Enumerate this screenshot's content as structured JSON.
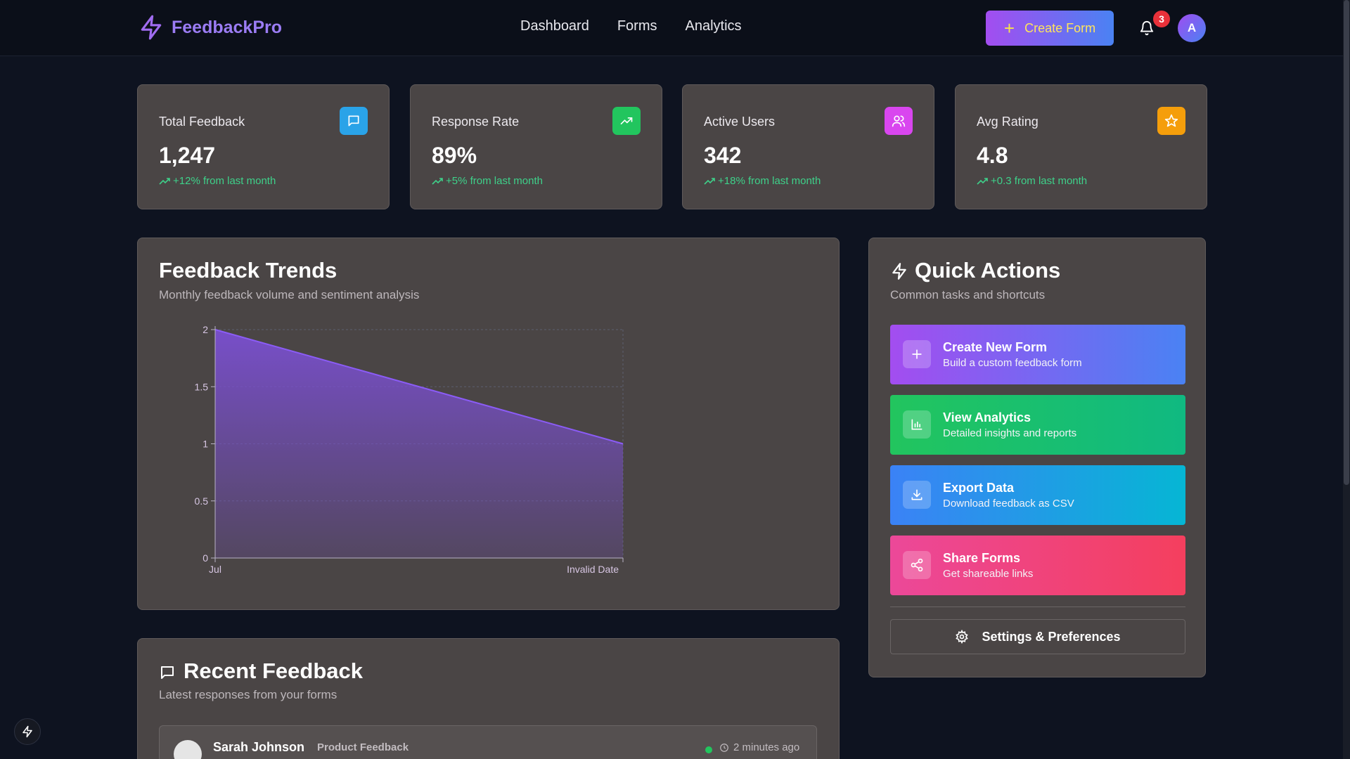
{
  "brand": {
    "name": "FeedbackPro"
  },
  "nav": {
    "items": [
      "Dashboard",
      "Forms",
      "Analytics"
    ]
  },
  "header": {
    "create_label": "Create Form",
    "notification_count": "3",
    "avatar_initial": "A"
  },
  "stats": [
    {
      "label": "Total Feedback",
      "value": "1,247",
      "change": "+12% from last month",
      "icon": "message-icon",
      "color": "#2aa3e8"
    },
    {
      "label": "Response Rate",
      "value": "89%",
      "change": "+5% from last month",
      "icon": "trending-up-icon",
      "color": "#22c55e"
    },
    {
      "label": "Active Users",
      "value": "342",
      "change": "+18% from last month",
      "icon": "users-icon",
      "color": "#d946ef"
    },
    {
      "label": "Avg Rating",
      "value": "4.8",
      "change": "+0.3 from last month",
      "icon": "star-icon",
      "color": "#f59e0b"
    }
  ],
  "trends": {
    "title": "Feedback Trends",
    "subtitle": "Monthly feedback volume and sentiment analysis"
  },
  "chart_data": {
    "type": "area",
    "x": [
      "Jul",
      "Invalid Date"
    ],
    "values": [
      2,
      1
    ],
    "yticks": [
      "0",
      "0.5",
      "1",
      "1.5",
      "2"
    ],
    "ylim": [
      0,
      2
    ],
    "grid": true,
    "fill_color": "#7a4fd0"
  },
  "quick_actions": {
    "title": "Quick Actions",
    "subtitle": "Common tasks and shortcuts",
    "items": [
      {
        "title": "Create New Form",
        "desc": "Build a custom feedback form",
        "icon": "plus-icon"
      },
      {
        "title": "View Analytics",
        "desc": "Detailed insights and reports",
        "icon": "bar-chart-icon"
      },
      {
        "title": "Export Data",
        "desc": "Download feedback as CSV",
        "icon": "download-icon"
      },
      {
        "title": "Share Forms",
        "desc": "Get shareable links",
        "icon": "share-icon"
      }
    ],
    "settings_label": "Settings & Preferences"
  },
  "recent": {
    "title": "Recent Feedback",
    "subtitle": "Latest responses from your forms",
    "items": [
      {
        "name": "Sarah Johnson",
        "form": "Product Feedback",
        "time": "2 minutes ago"
      }
    ]
  }
}
